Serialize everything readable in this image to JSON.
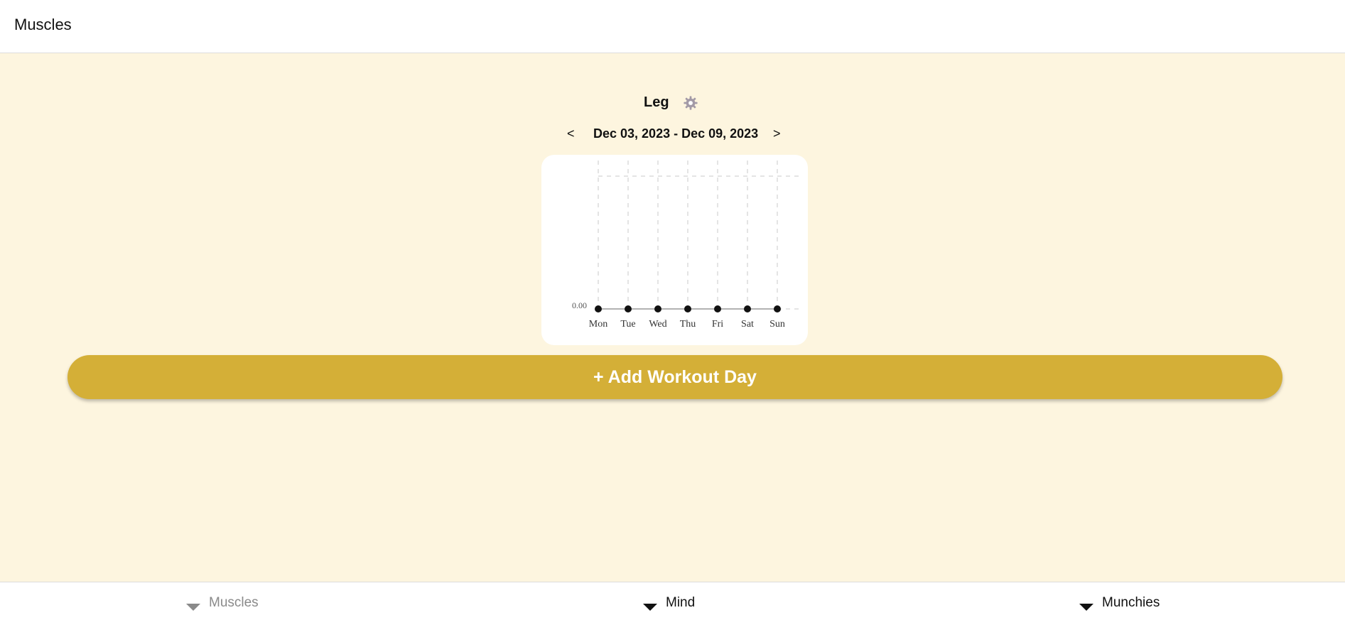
{
  "header": {
    "title": "Muscles"
  },
  "workout": {
    "title": "Leg",
    "settings_icon": "gear-icon"
  },
  "date_nav": {
    "prev_label": "<",
    "range": "Dec 03, 2023 - Dec 09, 2023",
    "next_label": ">"
  },
  "chart_data": {
    "type": "line",
    "categories": [
      "Mon",
      "Tue",
      "Wed",
      "Thu",
      "Fri",
      "Sat",
      "Sun"
    ],
    "series": [
      {
        "values": [
          0,
          0,
          0,
          0,
          0,
          0,
          0
        ]
      }
    ],
    "y_tick_labels": [
      "0.00"
    ],
    "grid": true
  },
  "actions": {
    "add_workout_label": "+ Add Workout Day"
  },
  "bottom_nav": {
    "items": [
      {
        "label": "Muscles",
        "state": "inactive"
      },
      {
        "label": "Mind",
        "state": "active"
      },
      {
        "label": "Munchies",
        "state": "active"
      }
    ]
  },
  "colors": {
    "background": "#fdf5df",
    "accent": "#d4af37",
    "gear": "#a39aa6"
  }
}
